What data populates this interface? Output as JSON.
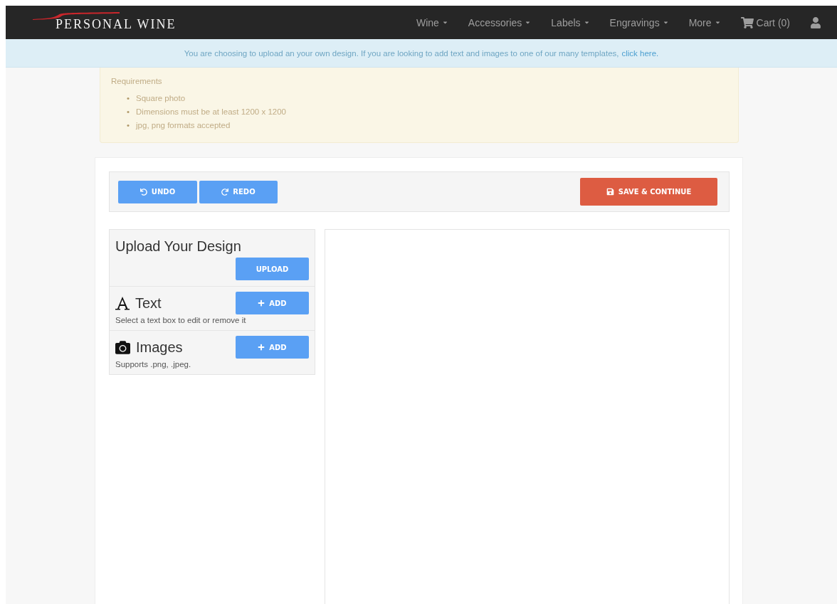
{
  "brand": {
    "name": "PERSONAL WINE"
  },
  "nav": [
    {
      "label": "Wine",
      "dropdown": true
    },
    {
      "label": "Accessories",
      "dropdown": true
    },
    {
      "label": "Labels",
      "dropdown": true
    },
    {
      "label": "Engravings",
      "dropdown": true
    },
    {
      "label": "More",
      "dropdown": true
    }
  ],
  "cart": {
    "label": "Cart (0)"
  },
  "notice": {
    "text": "You are choosing to upload an your own design. If you are looking to add text and images to one of our many templates,",
    "link": "click here."
  },
  "requirements": {
    "title": "Requirements",
    "bullet": "•",
    "items": [
      "Square photo",
      "Dimensions must be at least 1200 x 1200",
      "jpg, png formats accepted"
    ]
  },
  "toolbar": {
    "undo": "UNDO",
    "redo": "REDO",
    "save": "SAVE & CONTINUE"
  },
  "sections": [
    {
      "kind": "upload",
      "title": "Upload Your Design",
      "button": "UPLOAD"
    },
    {
      "kind": "text",
      "title": "Text",
      "button": "ADD",
      "description": "Select a text box to edit or remove it"
    },
    {
      "kind": "images",
      "title": "Images",
      "button": "ADD",
      "description": "Supports .png, .jpeg."
    }
  ]
}
